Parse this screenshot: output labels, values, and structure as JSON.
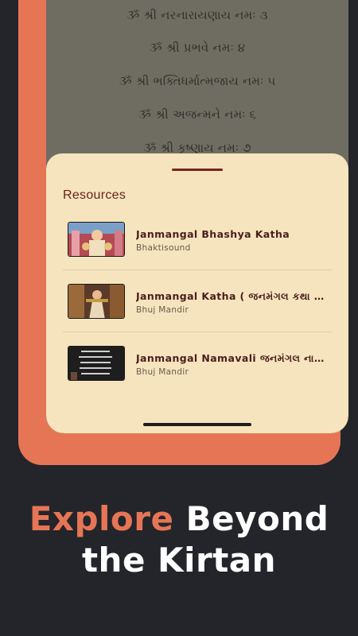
{
  "mantras": [
    "ૐ શ્રી નરનારાયણાય નમઃ ૩",
    "ૐ શ્રી પ્રભવે નમઃ ૪",
    "ૐ શ્રી ભક્તિધર્માત્મજાય નમઃ ૫",
    "ૐ શ્રી અજન્મને નમઃ ૬",
    "ૐ શ્રી કૃષ્ણાય નમઃ ૭"
  ],
  "sheet": {
    "title": "Resources",
    "items": [
      {
        "title": "Janmangal Bhashya Katha",
        "subtitle": "Bhaktisound",
        "thumb_icon": "deity-painting-thumbnail"
      },
      {
        "title": "Janmangal Katha ( જનમંગલ કથા )  by...",
        "subtitle": "Bhuj Mandir",
        "thumb_icon": "deity-video-thumbnail"
      },
      {
        "title": "Janmangal Namavali જનમંગલ નામવલી...",
        "subtitle": "Bhuj Mandir",
        "thumb_icon": "namavali-text-thumbnail"
      }
    ]
  },
  "tagline": {
    "accent": "Explore",
    "rest": " Beyond",
    "line2": "the Kirtan"
  },
  "colors": {
    "accent": "#e67556",
    "background": "#23252a",
    "sheet": "#f5e4bd",
    "title": "#6b1f1f"
  }
}
